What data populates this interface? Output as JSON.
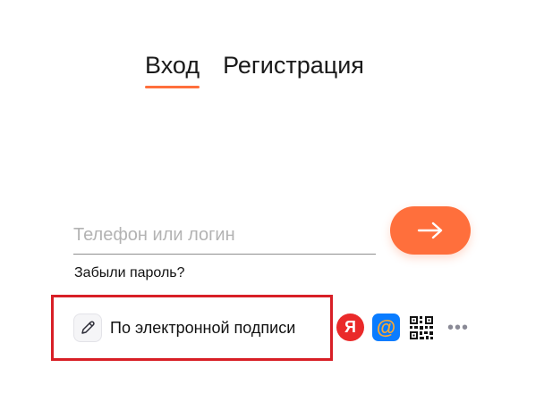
{
  "tabs": [
    {
      "label": "Вход",
      "active": true
    },
    {
      "label": "Регистрация",
      "active": false
    }
  ],
  "login_form": {
    "input_value": "",
    "input_placeholder": "Телефон или логин",
    "submit_icon": "arrow-right-icon",
    "forgot_password_label": "Забыли пароль?"
  },
  "alt_login": {
    "esign_label": "По электронной подписи",
    "esign_icon": "pen-icon",
    "yandex_glyph": "Я",
    "mail_glyph": "@",
    "qr_icon": "qr-code-icon",
    "more_glyph": "•••"
  },
  "colors": {
    "accent": "#ff6f3c",
    "highlight": "#d81f26",
    "yandex": "#ea2a2a",
    "mail": "#0a7cff"
  }
}
